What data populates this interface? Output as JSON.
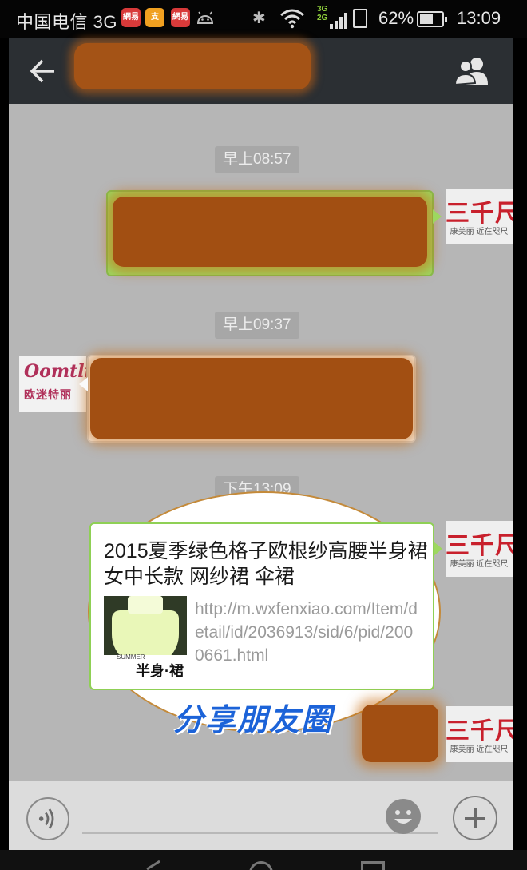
{
  "status_bar": {
    "carrier": "中国电信 3G",
    "network_type_top": "3G",
    "network_type_bottom": "2G",
    "battery_percent_text": "62%",
    "battery_level": 0.62,
    "time": "13:09",
    "notification_icons": [
      "netease-icon",
      "alipay-icon",
      "netease-icon",
      "android-icon"
    ]
  },
  "header": {
    "back_icon": "arrow-left-icon",
    "contacts_icon": "group-contacts-icon"
  },
  "chat": {
    "timestamps": [
      "早上08:57",
      "早上09:37",
      "下午13:09"
    ],
    "self_avatar_brand": "三千尺",
    "self_avatar_sub": "康美丽 近在咫尺",
    "contact_avatar_logo": "Oomtli",
    "contact_avatar_name": "欧迷特丽",
    "share_card": {
      "title": "2015夏季绿色格子欧根纱高腰半身裙女中长款 网纱裙 伞裙",
      "link": "http://m.wxfenxiao.com/Item/detail/id/2036913/sid/6/pid/2000661.html",
      "thumb_caption": "半身·裙",
      "thumb_caption_en": "SUMMER"
    },
    "annotation": "分享朋友圈"
  },
  "input_bar": {
    "voice_icon": "voice-icon",
    "emoji_icon": "emoji-icon",
    "plus_icon": "plus-icon"
  },
  "colors": {
    "outgoing_bubble": "#9dd760",
    "redaction": "#a24f12",
    "title_bar": "#2b2f33",
    "chat_bg": "#b6b6b6",
    "annotation_blue": "#1c63d8"
  }
}
